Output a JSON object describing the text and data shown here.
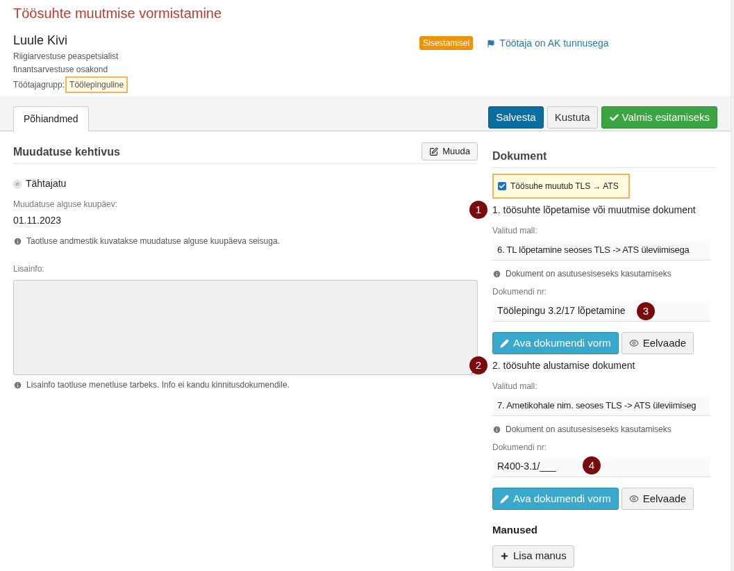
{
  "title": "Töösuhte muutmise vormistamine",
  "employee": {
    "name": "Luule Kivi",
    "position": "Riigiarvestuse peaspetsialist",
    "department": "finantsarvestuse osakond",
    "group_label": "Töötajagrupp:",
    "group": "Töölepinguline",
    "group_highlighted": true
  },
  "status_badge": "Sisestamisel",
  "flag_link": "Töötaja on AK tunnusega",
  "tabs": [
    {
      "label": "Põhiandmed",
      "selected": true
    }
  ],
  "actions": [
    {
      "label": "Salvesta",
      "kind": "primary"
    },
    {
      "label": "Kustuta",
      "kind": "default"
    },
    {
      "label": "Valmis esitamiseks",
      "kind": "success"
    }
  ],
  "validity": {
    "heading": "Muudatuse kehtivus",
    "edit_button": "Muuda",
    "radio": {
      "label": "Tähtajatu",
      "selected": true,
      "disabled": true
    },
    "date_label": "Muudatuse alguse kuupäev:",
    "date": "01.11.2023",
    "date_info": "Taotluse andmestik kuvatakse muudatuse alguse kuupäeva seisuga.",
    "notes_label": "Lisainfo:",
    "notes_info": "Lisainfo taotluse menetluse tarbeks. Info ei kandu kinnitusdokumendile."
  },
  "document": {
    "heading": "Dokument",
    "change_checkbox": {
      "label": "Töösuhe muutub TLS → ATS",
      "checked": true,
      "highlighted": true
    },
    "items": [
      {
        "marker": "1",
        "title": "1. töösuhte lõpetamise või muutmise dokument",
        "template_label": "Valitud mall:",
        "template": "6. TL lõpetamine seoses TLS -> ATS üleviimisega",
        "info": "Dokument on asutusesiseseks kasutamiseks",
        "number_label": "Dokumendi nr:",
        "number": "Töölepingu 3.2/17 lõpetamine",
        "number_marker": "3",
        "open_button": "Ava dokumendi vorm",
        "preview_button": "Eelvaade"
      },
      {
        "marker": "2",
        "title": "2. töösuhte alustamise dokument",
        "template_label": "Valitud mall:",
        "template": "7. Ametikohale nim. seoses TLS -> ATS üleviimiseg",
        "info": "Dokument on asutusesiseseks kasutamiseks",
        "number_label": "Dokumendi nr:",
        "number": "R400-3.1/___",
        "number_marker": "4",
        "open_button": "Ava dokumendi vorm",
        "preview_button": "Eelvaade"
      }
    ],
    "attachments_heading": "Manused",
    "add_attachment": "Lisa manus"
  }
}
